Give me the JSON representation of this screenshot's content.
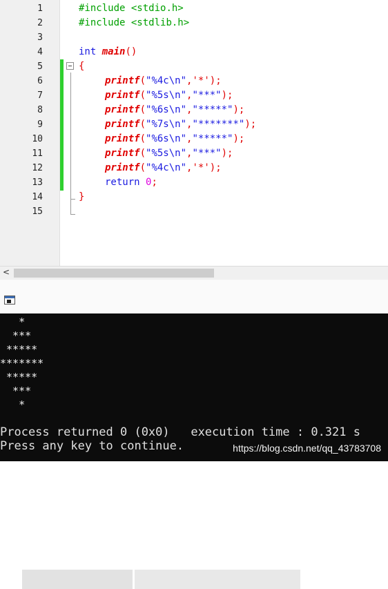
{
  "editor": {
    "line_numbers": [
      "1",
      "2",
      "3",
      "4",
      "5",
      "6",
      "7",
      "8",
      "9",
      "10",
      "11",
      "12",
      "13",
      "14",
      "15"
    ],
    "code": {
      "l1": {
        "directive": "#include",
        "header": "<stdio.h>"
      },
      "l2": {
        "directive": "#include",
        "header": "<stdlib.h>"
      },
      "l4": {
        "type": "int",
        "fn": "main",
        "parens": "()"
      },
      "l5": {
        "brace": "{"
      },
      "l6": {
        "fn": "printf",
        "open": "(",
        "fmt": "\"%4c\\n\"",
        "comma": ",",
        "arg": "'*'",
        "close": ");"
      },
      "l7": {
        "fn": "printf",
        "open": "(",
        "fmt": "\"%5s\\n\"",
        "comma": ",",
        "arg": "\"***\"",
        "close": ");"
      },
      "l8": {
        "fn": "printf",
        "open": "(",
        "fmt": "\"%6s\\n\"",
        "comma": ",",
        "arg": "\"*****\"",
        "close": ");"
      },
      "l9": {
        "fn": "printf",
        "open": "(",
        "fmt": "\"%7s\\n\"",
        "comma": ",",
        "arg": "\"*******\"",
        "close": ");"
      },
      "l10": {
        "fn": "printf",
        "open": "(",
        "fmt": "\"%6s\\n\"",
        "comma": ",",
        "arg": "\"*****\"",
        "close": ");"
      },
      "l11": {
        "fn": "printf",
        "open": "(",
        "fmt": "\"%5s\\n\"",
        "comma": ",",
        "arg": "\"***\"",
        "close": ");"
      },
      "l12": {
        "fn": "printf",
        "open": "(",
        "fmt": "\"%4c\\n\"",
        "comma": ",",
        "arg": "'*'",
        "close": ");"
      },
      "l13": {
        "kw": "return",
        "val": "0",
        "semi": ";"
      },
      "l14": {
        "brace": "}"
      }
    }
  },
  "scrollbar": {
    "left_arrow": "<"
  },
  "terminal": {
    "output": [
      "   *",
      "  ***",
      " *****",
      "*******",
      " *****",
      "  ***",
      "   *"
    ],
    "process_line": "Process returned 0 (0x0)   execution time : 0.321 s",
    "press_line": "Press any key to continue."
  },
  "watermark": "https://blog.csdn.net/qq_43783708",
  "colors": {
    "preprocessor": "#00a000",
    "keyword": "#1a1ae0",
    "function": "#e00000",
    "number": "#e000e0",
    "terminal_bg": "#0c0c0c"
  }
}
